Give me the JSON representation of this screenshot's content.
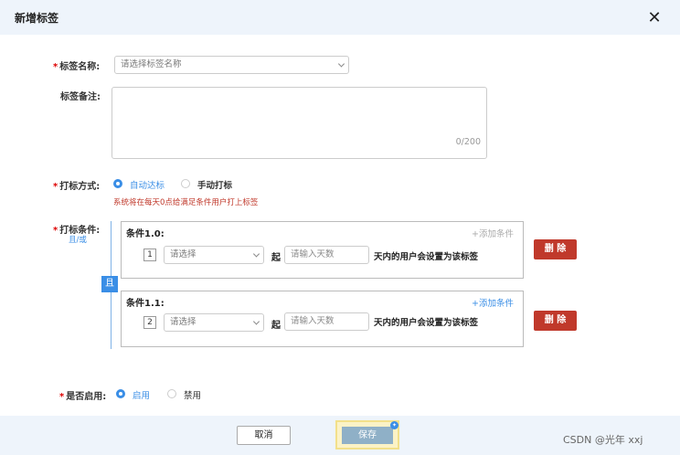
{
  "dialog": {
    "title": "新增标签"
  },
  "form": {
    "required_mark": "*",
    "name": {
      "label": "标签名称:",
      "placeholder": "请选择标签名称"
    },
    "remark": {
      "label": "标签备注:",
      "counter": "0/200"
    },
    "method": {
      "label": "打标方式:",
      "options": [
        {
          "label": "自动达标",
          "selected": true
        },
        {
          "label": "手动打标",
          "selected": false
        }
      ],
      "hint": "系统将在每天0点给满足条件用户打上标签"
    },
    "conditions": {
      "label": "打标条件:",
      "andor": "且/或",
      "and_badge": "且",
      "qi": "起",
      "tail": "天内的用户会设置为该标签",
      "select_placeholder": "请选择",
      "days_placeholder": "请输入天数",
      "add_label": "+添加条件",
      "delete_label": "删 除",
      "items": [
        {
          "title": "条件1.0:",
          "index": "1",
          "add_enabled": false
        },
        {
          "title": "条件1.1:",
          "index": "2",
          "add_enabled": true
        }
      ]
    },
    "enable": {
      "label": "是否启用:",
      "options": [
        {
          "label": "启用",
          "selected": true
        },
        {
          "label": "禁用",
          "selected": false
        }
      ]
    }
  },
  "footer": {
    "cancel_label": "取消",
    "save_label": "保存"
  },
  "watermark": "CSDN @光年 xxj",
  "colors": {
    "accent": "#3a8ee6",
    "danger": "#c0392b",
    "header_bg": "#eef4fb"
  }
}
